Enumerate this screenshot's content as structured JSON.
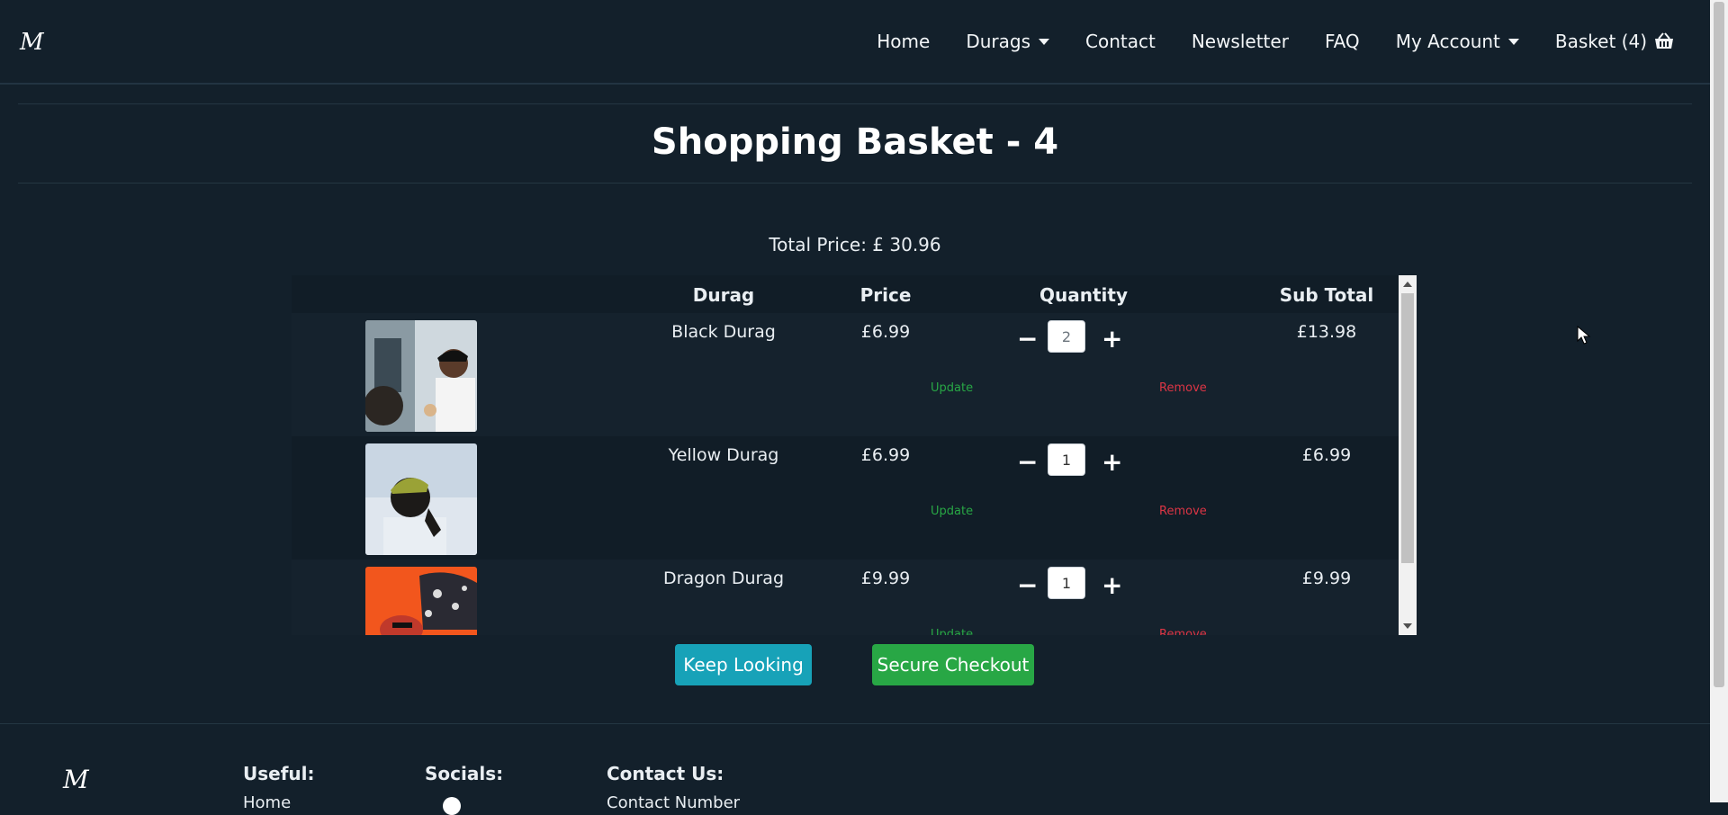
{
  "nav": {
    "logo": "M",
    "items": [
      "Home",
      "Durags",
      "Contact",
      "Newsletter",
      "FAQ",
      "My Account",
      "Basket (4)"
    ]
  },
  "basket": {
    "title": "Shopping Basket - 4",
    "total_price": "Total Price: £ 30.96",
    "columns": [
      "Durag",
      "Price",
      "Quantity",
      "Sub Total"
    ],
    "items": [
      {
        "name": "Black Durag",
        "price": "£6.99",
        "qty": "2",
        "subtotal": "£13.98",
        "update": "Update",
        "remove": "Remove"
      },
      {
        "name": "Yellow Durag",
        "price": "£6.99",
        "qty": "1",
        "subtotal": "£6.99",
        "update": "Update",
        "remove": "Remove"
      },
      {
        "name": "Dragon Durag",
        "price": "£9.99",
        "qty": "1",
        "subtotal": "£9.99",
        "update": "Update",
        "remove": "Remove"
      }
    ],
    "minus": "−",
    "plus": "+",
    "keep_looking": "Keep Looking",
    "secure_checkout": "Secure Checkout"
  },
  "footer": {
    "logo": "M",
    "useful": "Useful:",
    "useful_first": "Home",
    "socials": "Socials:",
    "contact": "Contact Us:",
    "contact_first": "Contact Number"
  },
  "colors": {
    "background": "#13202b",
    "update": "#28a745",
    "remove": "#dc3545",
    "keep": "#17a2b8",
    "checkout": "#28a745"
  }
}
